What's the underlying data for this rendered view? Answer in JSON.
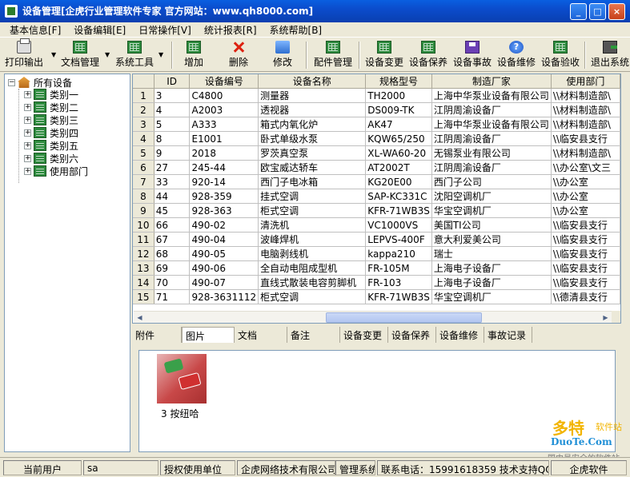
{
  "window": {
    "title": "设备管理[企虎行业管理软件专家  官方网站：www.qh8000.com]",
    "minimize": "_",
    "maximize": "□",
    "close": "×"
  },
  "menu": [
    "基本信息[F]",
    "设备编辑[E]",
    "日常操作[V]",
    "统计报表[R]",
    "系统帮助[B]"
  ],
  "toolbar": {
    "print": "打印输出",
    "docs": "文档管理",
    "system": "系统工具",
    "add": "增加",
    "delete": "删除",
    "edit": "修改",
    "parts": "配件管理",
    "change": "设备变更",
    "maintain": "设备保养",
    "accident": "设备事故",
    "repair": "设备维修",
    "accept": "设备验收",
    "exit": "退出系统",
    "drop_arrow": "▼"
  },
  "tree": {
    "root": "所有设备",
    "items": [
      "类别一",
      "类别二",
      "类别三",
      "类别四",
      "类别五",
      "类别六",
      "使用部门"
    ],
    "expander": "+",
    "root_expander": "−"
  },
  "grid": {
    "columns": [
      "",
      "ID",
      "设备编号",
      "设备名称",
      "规格型号",
      "制造厂家",
      "使用部门"
    ],
    "rows": [
      [
        "1",
        "3",
        "C4800",
        "测量器",
        "TH2000",
        "上海中华泵业设备有限公司",
        "\\\\材料制造部\\"
      ],
      [
        "2",
        "4",
        "A2003",
        "透视器",
        "DS009-TK",
        "江阴周渝设备厂",
        "\\\\材料制造部\\"
      ],
      [
        "3",
        "5",
        "A333",
        "箱式内氧化炉",
        "AK47",
        "上海中华泵业设备有限公司",
        "\\\\材料制造部\\"
      ],
      [
        "4",
        "8",
        "E1001",
        "卧式单级水泵",
        "KQW65/250",
        "江阴周渝设备厂",
        "\\\\临安县支行"
      ],
      [
        "5",
        "9",
        "2018",
        "罗茨真空泵",
        "XL-WA60-20",
        "无锡泵业有限公司",
        "\\\\材料制造部\\"
      ],
      [
        "6",
        "27",
        "245-44",
        "欧宝威达轿车",
        "AT2002T",
        "江阴周渝设备厂",
        "\\\\办公室\\文三"
      ],
      [
        "7",
        "33",
        "920-14",
        "西门子电冰箱",
        "KG20E00",
        "西门子公司",
        "\\\\办公室"
      ],
      [
        "8",
        "44",
        "928-359",
        "挂式空调",
        "SAP-KC331C",
        "沈阳空调机厂",
        "\\\\办公室"
      ],
      [
        "9",
        "45",
        "928-363",
        "柜式空调",
        "KFR-71WB3S",
        "华宝空调机厂",
        "\\\\办公室"
      ],
      [
        "10",
        "66",
        "490-02",
        "清洗机",
        "VC1000VS",
        "美国TI公司",
        "\\\\临安县支行"
      ],
      [
        "11",
        "67",
        "490-04",
        "波峰焊机",
        "LEPVS-400F",
        "意大利爱美公司",
        "\\\\临安县支行"
      ],
      [
        "12",
        "68",
        "490-05",
        "电脑剥线机",
        "kappa210",
        "瑞士",
        "\\\\临安县支行"
      ],
      [
        "13",
        "69",
        "490-06",
        "全自动电阻成型机",
        "FR-105M",
        "上海电子设备厂",
        "\\\\临安县支行"
      ],
      [
        "14",
        "70",
        "490-07",
        "直线式散装电容剪脚机",
        "FR-103",
        "上海电子设备厂",
        "\\\\临安县支行"
      ],
      [
        "15",
        "71",
        "928-3631112",
        "柜式空调",
        "KFR-71WB3S",
        "华宝空调机厂",
        "\\\\德清县支行"
      ]
    ],
    "scroll_left": "◀",
    "scroll_right": "▶"
  },
  "tabs": [
    "附件",
    "图片",
    "文档",
    "备注",
    "设备变更",
    "设备保养",
    "设备维修",
    "事故记录"
  ],
  "active_tab": "图片",
  "attachment": {
    "caption": "3 按纽哈"
  },
  "watermark": {
    "brand": "多特",
    "sub": "软件站",
    "url": "DuoTe.Com",
    "tag": "国内最安全的软件站"
  },
  "statusbar": {
    "current_user_label": "当前用户",
    "current_user": "sa",
    "license_label": "授权使用单位",
    "license_unit": "企虎网络技术有限公司",
    "system": "管理系统",
    "contact": "联系电话：15991618359  技术支持QQ",
    "vendor": "企虎软件"
  }
}
